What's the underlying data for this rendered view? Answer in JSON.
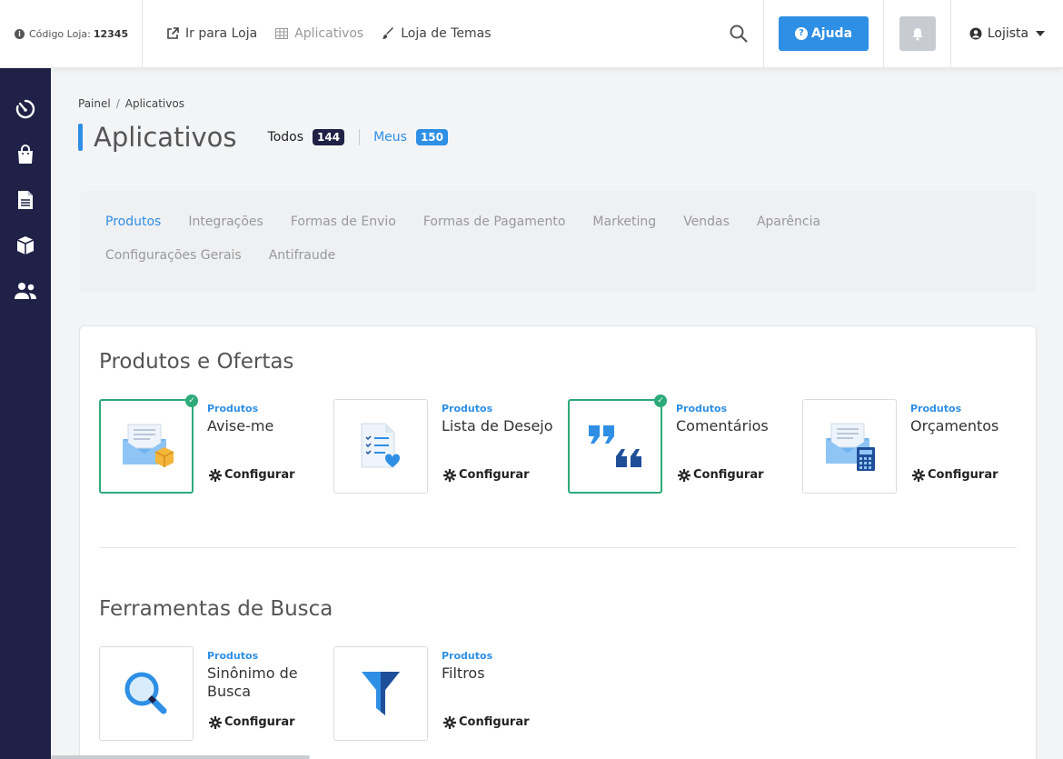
{
  "topbar": {
    "store_code_label": "Código Loja:",
    "store_code_value": "12345",
    "nav": [
      {
        "label": "Ir para Loja",
        "icon": "external-link-icon"
      },
      {
        "label": "Aplicativos",
        "icon": "grid-icon"
      },
      {
        "label": "Loja de Temas",
        "icon": "brush-icon"
      }
    ],
    "help_label": "Ajuda",
    "user_label": "Lojista"
  },
  "sidebar": {
    "items": [
      "dashboard-icon",
      "shopping-bag-icon",
      "document-icon",
      "box-icon",
      "users-icon"
    ]
  },
  "breadcrumb": {
    "root": "Painel",
    "current": "Aplicativos"
  },
  "page": {
    "title": "Aplicativos",
    "tab_all_label": "Todos",
    "tab_all_count": "144",
    "tab_mine_label": "Meus",
    "tab_mine_count": "150"
  },
  "categories": [
    "Produtos",
    "Integrações",
    "Formas de Envio",
    "Formas de Pagamento",
    "Marketing",
    "Vendas",
    "Aparência",
    "Configurações Gerais",
    "Antifraude"
  ],
  "sections": [
    {
      "title": "Produtos e Ofertas",
      "apps": [
        {
          "category": "Produtos",
          "name": "Avise-me",
          "config": "Configurar",
          "installed": true
        },
        {
          "category": "Produtos",
          "name": "Lista de Desejo",
          "config": "Configurar",
          "installed": false
        },
        {
          "category": "Produtos",
          "name": "Comentários",
          "config": "Configurar",
          "installed": true
        },
        {
          "category": "Produtos",
          "name": "Orçamentos",
          "config": "Configurar",
          "installed": false
        }
      ]
    },
    {
      "title": "Ferramentas de Busca",
      "apps": [
        {
          "category": "Produtos",
          "name": "Sinônimo de Busca",
          "config": "Configurar",
          "installed": false
        },
        {
          "category": "Produtos",
          "name": "Filtros",
          "config": "Configurar",
          "installed": false
        }
      ]
    }
  ],
  "colors": {
    "accent": "#2e8fe5",
    "sidebar": "#1f2147",
    "installed": "#2eaa7a"
  }
}
